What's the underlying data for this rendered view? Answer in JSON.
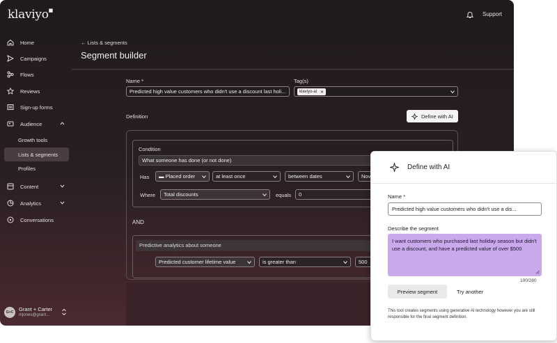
{
  "app": {
    "logo": "klaviyo",
    "support": "Support"
  },
  "sidebar": {
    "items": [
      {
        "label": "Home",
        "icon": "home-icon"
      },
      {
        "label": "Campaigns",
        "icon": "send-icon"
      },
      {
        "label": "Flows",
        "icon": "flows-icon"
      },
      {
        "label": "Reviews",
        "icon": "star-icon"
      },
      {
        "label": "Sign-up forms",
        "icon": "form-icon"
      },
      {
        "label": "Audience",
        "icon": "people-icon"
      },
      {
        "label": "Content",
        "icon": "content-icon"
      },
      {
        "label": "Analytics",
        "icon": "analytics-icon"
      },
      {
        "label": "Conversations",
        "icon": "chat-icon"
      }
    ],
    "audience_sub": [
      "Growth tools",
      "Lists & segments",
      "Profiles"
    ],
    "account": {
      "initials": "G+C",
      "name": "Grant + Carter",
      "email": "mjones@grant..."
    }
  },
  "main": {
    "breadcrumb": "Lists & segments",
    "title": "Segment builder",
    "name_label": "Name *",
    "name_value": "Predicted high value customers who didn't use a discount last holi...",
    "tags_label": "Tag(s)",
    "tag_chip": "klaviyo-ai",
    "definition_label": "Definition",
    "define_ai_button": "Define with AI",
    "condition_label": "Condition",
    "condition_type": "What someone has done (or not done)",
    "has_label": "Has",
    "placed_order": "Placed order",
    "frequency": "at least once",
    "timeframe": "between dates",
    "date_start": "Nov",
    "where_label": "Where",
    "property": "Total discounts",
    "operator": "equals",
    "property_value": "0",
    "and_label": "AND",
    "predictive_type": "Predictive analytics about someone",
    "predictive_metric": "Predicted customer lifetime value",
    "predictive_operator": "is greater than",
    "predictive_value": "500"
  },
  "ai_panel": {
    "title": "Define with AI",
    "name_label": "Name *",
    "name_value": "Predicted high value customers who didn't use a dis...",
    "describe_label": "Describe the segment",
    "description": "I want customers who purchased last holiday season but didn't use a discount, and have a predicted value of over $500",
    "counter": "100/280",
    "preview_button": "Preview segment",
    "try_button": "Try another",
    "disclaimer": "This tool creates segments using generative AI technology however you are still responsible for the final segment definition."
  }
}
